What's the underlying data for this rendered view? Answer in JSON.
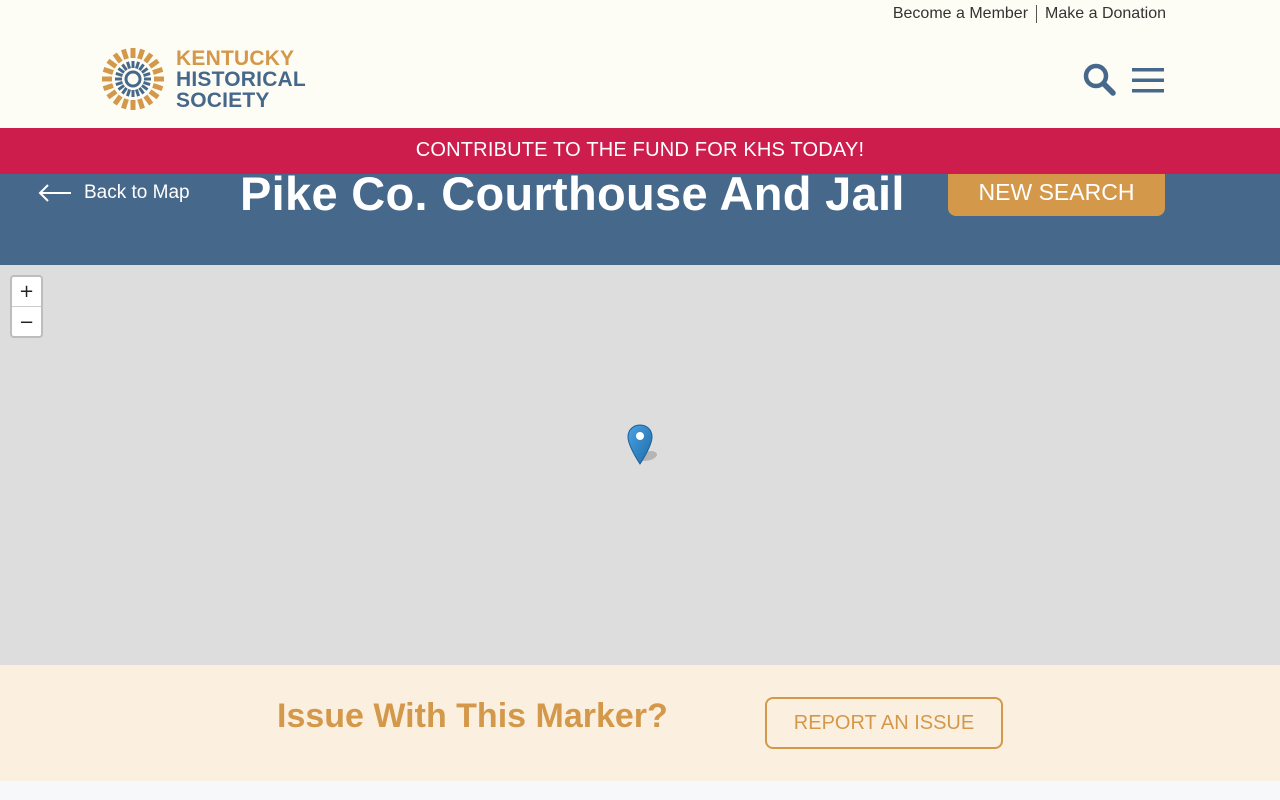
{
  "utility_nav": {
    "member": "Become a Member",
    "donate": "Make a Donation"
  },
  "logo": {
    "line1": "KENTUCKY",
    "line2": "HISTORICAL",
    "line3": "SOCIETY"
  },
  "header": {
    "search_icon": "search-icon",
    "menu_icon": "hamburger-menu-icon"
  },
  "promo": {
    "text": "CONTRIBUTE TO THE FUND FOR KHS TODAY!"
  },
  "marker_page": {
    "back_label": "Back to Map",
    "title": "Pike Co. Courthouse And Jail",
    "new_search": "NEW SEARCH"
  },
  "map": {
    "zoom_in": "+",
    "zoom_out": "−",
    "marker_icon": "map-pin-icon"
  },
  "issue": {
    "heading": "Issue With This Marker?",
    "report_button": "REPORT AN ISSUE"
  },
  "colors": {
    "cream": "#fefdf5",
    "crimson": "#cc1d4c",
    "slate_blue": "#46688b",
    "gold": "#d4984a",
    "map_gray": "#dddddd",
    "issue_bg": "#fbf0e0"
  }
}
